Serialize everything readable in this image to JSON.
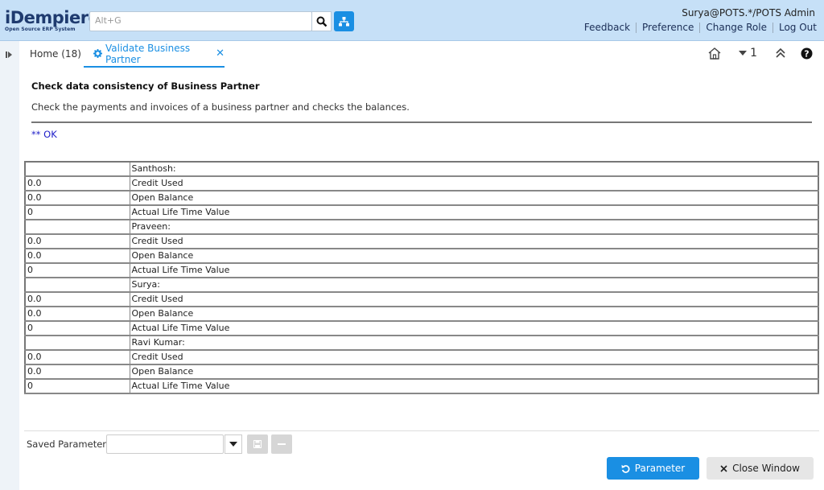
{
  "header": {
    "logo_main": "iDempiere",
    "logo_sub": "Open Source ERP System",
    "search_placeholder": "Alt+G",
    "user": "Surya@POTS.*/POTS Admin",
    "links": [
      "Feedback",
      "Preference",
      "Change Role",
      "Log Out"
    ]
  },
  "tabs": {
    "home": "Home (18)",
    "active": "Validate Business Partner",
    "window_count": "1"
  },
  "process": {
    "title": "Check data consistency of Business Partner",
    "description": "Check the payments and invoices of a business partner and checks the balances.",
    "status": "** OK"
  },
  "table": {
    "rows": [
      [
        "",
        "Santhosh:"
      ],
      [
        "0.0",
        "Credit Used"
      ],
      [
        "0.0",
        "Open Balance"
      ],
      [
        "0",
        "Actual Life Time Value"
      ],
      [
        "",
        "Praveen:"
      ],
      [
        "0.0",
        "Credit Used"
      ],
      [
        "0.0",
        "Open Balance"
      ],
      [
        "0",
        "Actual Life Time Value"
      ],
      [
        "",
        "Surya:"
      ],
      [
        "0.0",
        "Credit Used"
      ],
      [
        "0.0",
        "Open Balance"
      ],
      [
        "0",
        "Actual Life Time Value"
      ],
      [
        "",
        "Ravi Kumar:"
      ],
      [
        "0.0",
        "Credit Used"
      ],
      [
        "0.0",
        "Open Balance"
      ],
      [
        "0",
        "Actual Life Time Value"
      ]
    ]
  },
  "footer": {
    "saved_parameters_label": "Saved Parameters",
    "parameter_button": "Parameter",
    "close_window_button": "Close Window"
  },
  "colors": {
    "header_bg": "#c6e0f7",
    "accent": "#1a8fe3",
    "ok_text": "#1c1cc8"
  }
}
